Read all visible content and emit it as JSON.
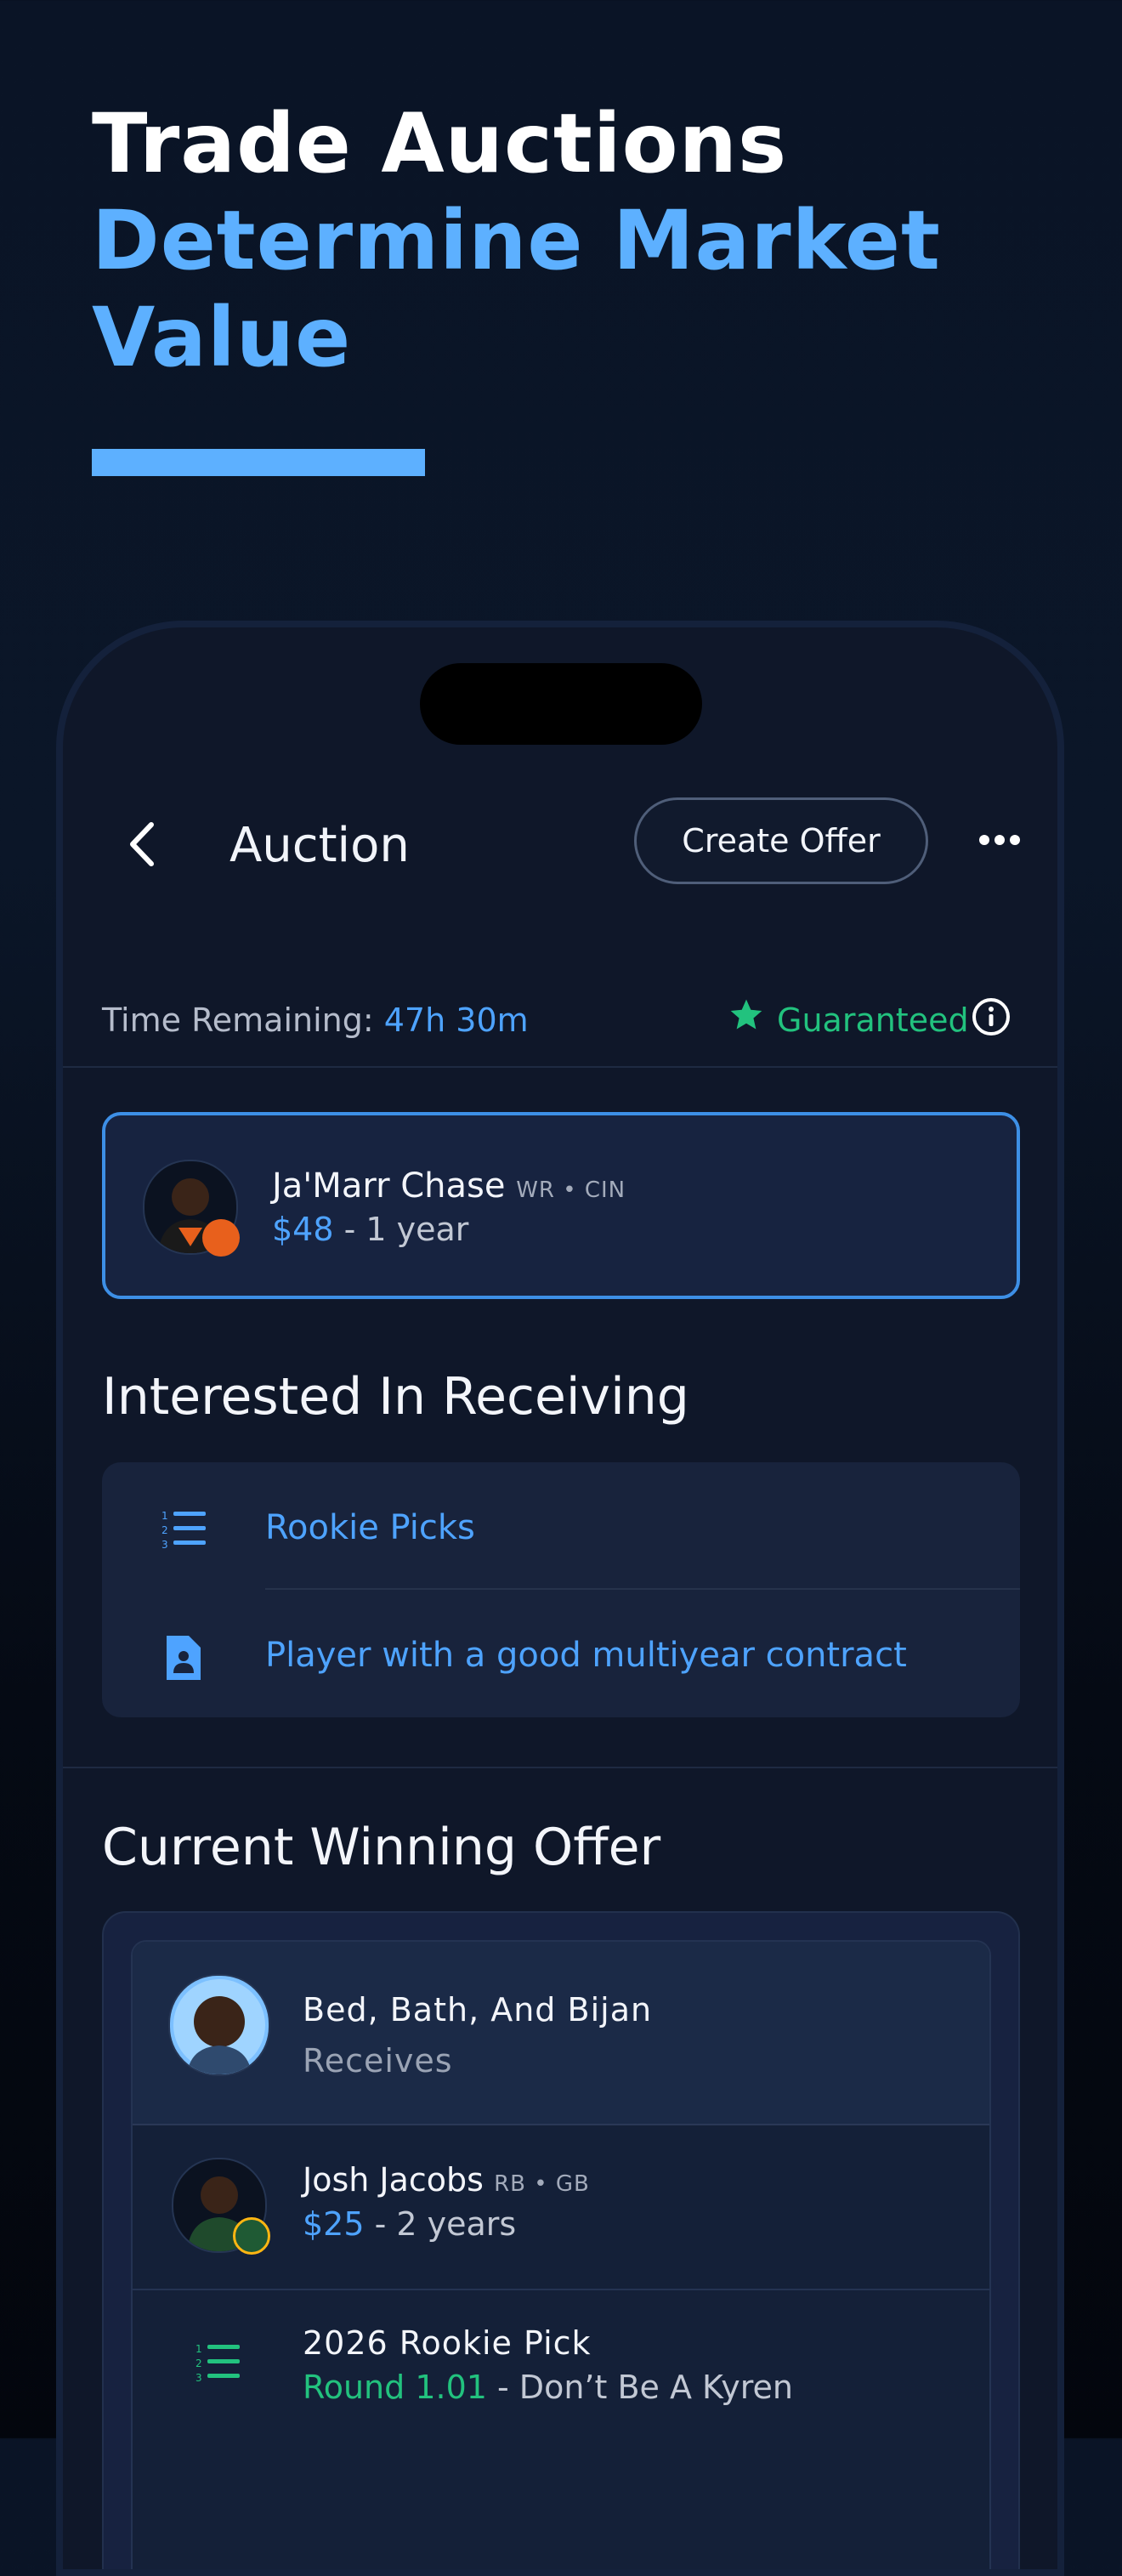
{
  "hero": {
    "line1": "Trade Auctions",
    "line2": "Determine Market",
    "line3": "Value"
  },
  "nav": {
    "title": "Auction",
    "create_offer": "Create Offer"
  },
  "status": {
    "time_label": "Time Remaining: ",
    "time_value": "47h 30m",
    "guaranteed": "Guaranteed"
  },
  "player": {
    "name": "Ja'Marr Chase",
    "meta": "WR • CIN",
    "price": "$48",
    "term": " - 1 year"
  },
  "interested": {
    "heading": "Interested In Receiving",
    "items": [
      {
        "label": "Rookie Picks",
        "icon": "numbered-list-icon"
      },
      {
        "label": "Player with a good multiyear contract",
        "icon": "person-document-icon"
      }
    ]
  },
  "winning": {
    "heading": "Current Winning Offer",
    "team": "Bed, Bath, And Bijan",
    "receives": "Receives",
    "player_name": "Josh Jacobs",
    "player_meta": "RB • GB",
    "player_price": "$25",
    "player_term": " - 2 years",
    "pick_title": "2026 Rookie Pick",
    "pick_round": "Round 1.01",
    "pick_owner": " - Don’t Be A Kyren"
  },
  "colors": {
    "accent": "#4ea3ff",
    "hero_accent": "#5db0ff",
    "guaranteed": "#22c27e",
    "background": "#0b1628"
  }
}
